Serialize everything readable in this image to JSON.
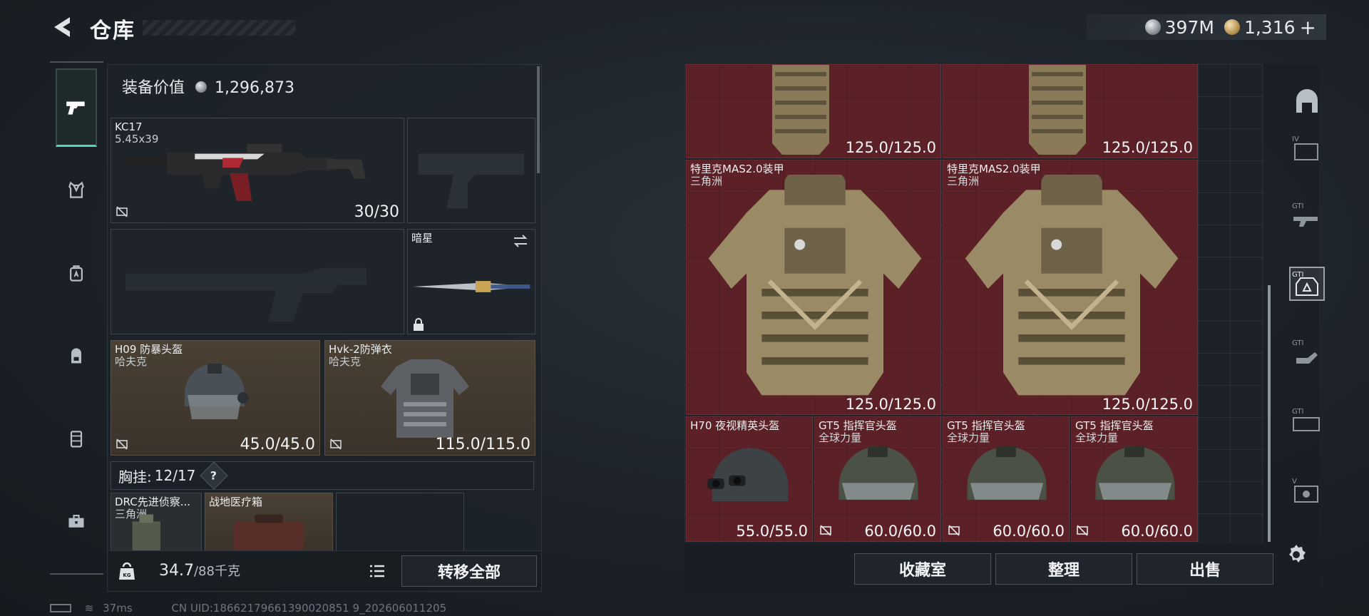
{
  "header": {
    "title": "仓库",
    "currency_silver": "397M",
    "currency_gold": "1,316",
    "plus": "+"
  },
  "sidebar": {
    "items": [
      {
        "icon": "pistol-icon",
        "active": true
      },
      {
        "icon": "armor-vest-icon"
      },
      {
        "icon": "backpack-a-icon"
      },
      {
        "icon": "backpack-icon"
      },
      {
        "icon": "locker-icon"
      },
      {
        "icon": "toolbox-icon"
      }
    ]
  },
  "loadout": {
    "equip_value_label": "装备价值",
    "equip_value": "1,296,873",
    "primary": {
      "name": "KC17",
      "caliber": "5.45x39",
      "count": "30/30"
    },
    "melee": {
      "name": "暗星"
    },
    "helmet": {
      "name": "H09 防暴头盔",
      "origin": "哈夫克",
      "count": "45.0/45.0"
    },
    "armor": {
      "name": "Hvk-2防弹衣",
      "origin": "哈夫克",
      "count": "115.0/115.0"
    },
    "chest_label": "胸挂:",
    "chest_count": "12/17",
    "help": "?",
    "chest_items": [
      {
        "name": "DRC先进侦察...",
        "origin": "三角洲"
      },
      {
        "name": "战地医疗箱"
      }
    ],
    "weight": "34.7",
    "weight_max": "/88千克",
    "transfer_all": "转移全部"
  },
  "stash": {
    "items": [
      {
        "count": "125.0/125.0"
      },
      {
        "count": "125.0/125.0"
      },
      {
        "name": "特里克MAS2.0装甲",
        "origin": "三角洲",
        "count": "125.0/125.0"
      },
      {
        "name": "特里克MAS2.0装甲",
        "origin": "三角洲",
        "count": "125.0/125.0"
      },
      {
        "name": "H70 夜视精英头盔",
        "count": "55.0/55.0"
      },
      {
        "name": "GT5 指挥官头盔",
        "origin": "全球力量",
        "count": "60.0/60.0"
      },
      {
        "name": "GT5 指挥官头盔",
        "origin": "全球力量",
        "count": "60.0/60.0"
      },
      {
        "name": "GT5 指挥官头盔",
        "origin": "全球力量",
        "count": "60.0/60.0"
      }
    ],
    "buttons": {
      "collection": "收藏室",
      "organize": "整理",
      "sell": "出售"
    },
    "categories": [
      "home-icon",
      "tier-iv-icon",
      "gti-rifle-icon",
      "gti-armor-icon",
      "gti-hand-icon",
      "gti-case-icon",
      "tier-v-icon"
    ]
  },
  "status": {
    "ping": "37ms",
    "uid": "CN UID:18662179661390020851 9_202606011205"
  },
  "colors": {
    "accent": "#57d3c2",
    "stash_cell": "#5c2126",
    "slot_tan": "#4a4034"
  }
}
